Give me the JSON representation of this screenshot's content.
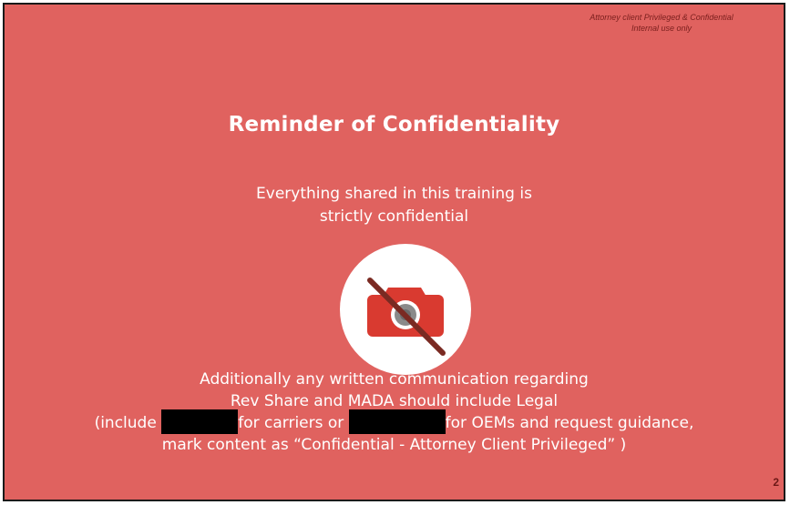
{
  "slide": {
    "legend": {
      "line1": "Attorney client Privileged & Confidential",
      "line2": "Internal use only"
    },
    "title": "Reminder of Confidentiality",
    "subtitle": {
      "line1": "Everything shared in this training is",
      "line2": "strictly confidential"
    },
    "icon": "no-camera-icon",
    "body": {
      "line1": "Additionally any written communication regarding",
      "line2": "Rev Share and MADA should include Legal",
      "line3_prefix": "(include ",
      "line3_middle": "for carriers or ",
      "line3_suffix": "for OEMs and request guidance,",
      "line4": "mark content as “Confidential - Attorney Client Privileged” )"
    },
    "page_number": "2"
  },
  "colors": {
    "background": "#e0625f",
    "icon_red": "#d93a30",
    "text": "#ffffff",
    "redaction": "#000000"
  }
}
